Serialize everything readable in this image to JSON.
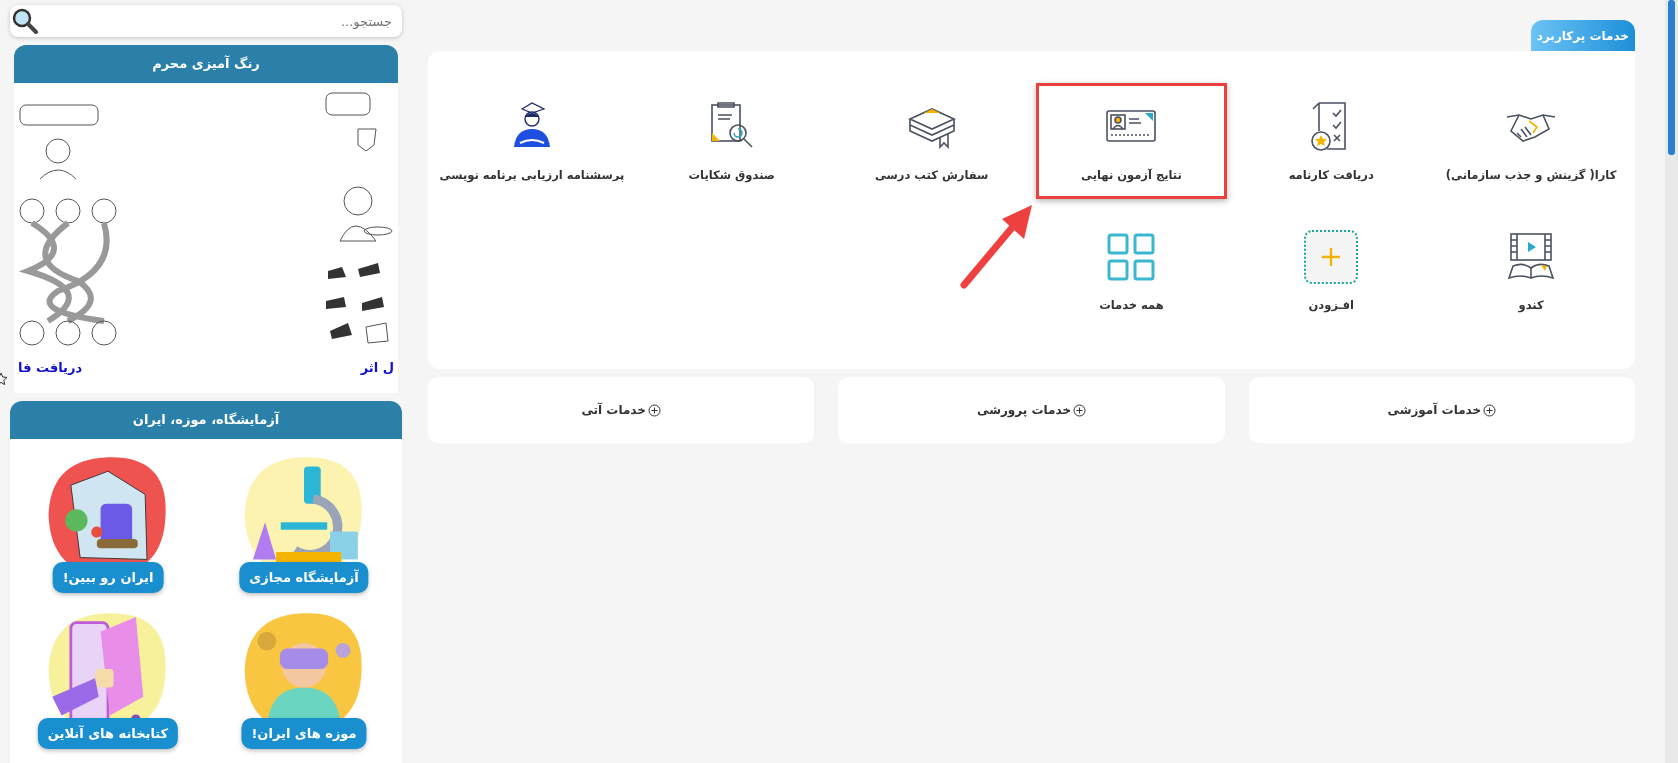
{
  "search": {
    "placeholder": "جستجو..."
  },
  "sidebar": {
    "coloring_card": {
      "title": "رنگ آمیزی محرم",
      "links": [
        "ل اثر",
        "دریافت فا"
      ]
    },
    "lab_card": {
      "title": "آزمایشگاه، موزه، ایران",
      "tiles": [
        {
          "label": "آزمایشگاه مجازی"
        },
        {
          "label": "ایران رو ببین!"
        },
        {
          "label": "موزه های ایران!"
        },
        {
          "label": "کتابخانه های آنلاین"
        }
      ]
    }
  },
  "services": {
    "title": "خدمات پرکاربرد",
    "items": [
      {
        "label": "کارا( گزینش و جذب سازمانی)",
        "kind": "service",
        "selected": false
      },
      {
        "label": "دریافت کارنامه",
        "kind": "service",
        "selected": false
      },
      {
        "label": "نتایج آزمون نهایی",
        "kind": "service",
        "selected": true
      },
      {
        "label": "سفارش کتب درسی",
        "kind": "service",
        "selected": false
      },
      {
        "label": "صندوق شکایات",
        "kind": "service",
        "selected": false
      },
      {
        "label": "پرسشنامه ارزیابی برنامه نویسی",
        "kind": "service",
        "selected": false
      },
      {
        "label": "کندو",
        "kind": "service",
        "selected": false
      },
      {
        "label": "افـزودن",
        "kind": "add",
        "selected": false
      },
      {
        "label": "همه خدمات",
        "kind": "all",
        "selected": false
      }
    ]
  },
  "categories": [
    {
      "label": "خدمات آموزشی"
    },
    {
      "label": "خدمات پرورشی"
    },
    {
      "label": "خدمات آتی"
    }
  ]
}
